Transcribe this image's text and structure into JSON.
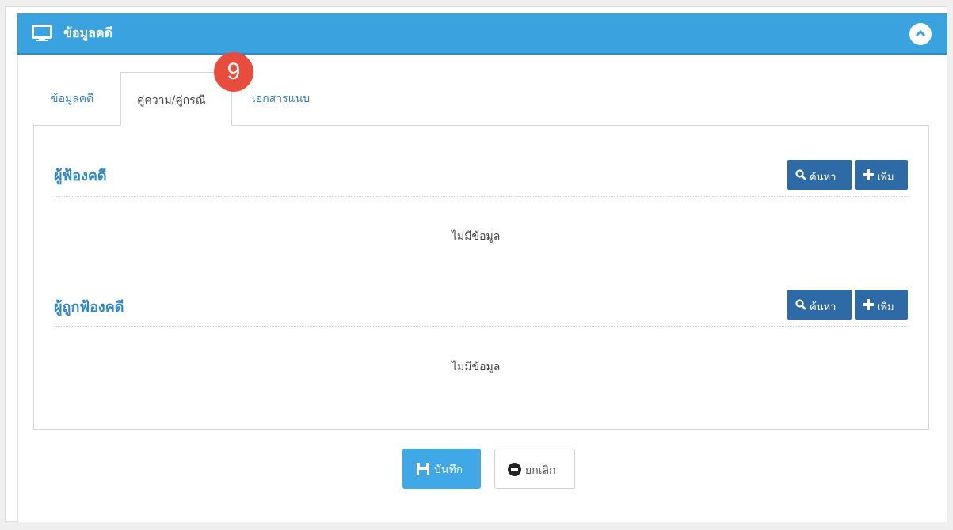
{
  "panel": {
    "title": "ข้อมูลคดี"
  },
  "badge": {
    "number": "9"
  },
  "tabs": [
    {
      "label": "ข้อมูลคดี"
    },
    {
      "label": "คู่ความ/คู่กรณี"
    },
    {
      "label": "เอกสารแนบ"
    }
  ],
  "sections": [
    {
      "title": "ผู้ฟ้องคดี",
      "search_label": "ค้นหา",
      "add_label": "เพิ่ม",
      "empty_text": "ไม่มีข้อมูล"
    },
    {
      "title": "ผู้ถูกฟ้องคดี",
      "search_label": "ค้นหา",
      "add_label": "เพิ่ม",
      "empty_text": "ไม่มีข้อมูล"
    }
  ],
  "footer": {
    "save_label": "บันทึก",
    "cancel_label": "ยกเลิก"
  },
  "colors": {
    "header": "#3aa2df",
    "primary_button": "#2d6aa6",
    "save_button": "#41a8e8",
    "badge": "#e84c3d",
    "title_text": "#2f86c8"
  },
  "icons": {
    "header": "monitor-icon",
    "collapse": "chevron-up-icon",
    "search": "search-icon",
    "add": "plus-icon",
    "save": "floppy-disk-icon",
    "cancel": "remove-circle-icon"
  }
}
